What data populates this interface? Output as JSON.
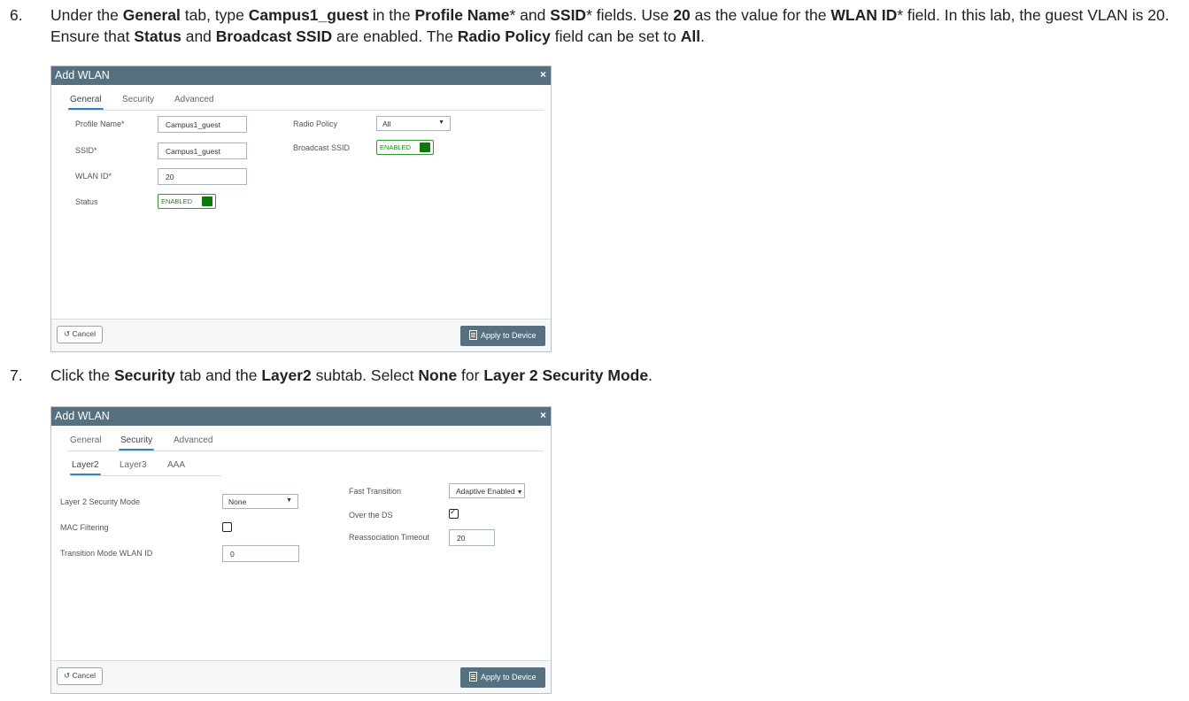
{
  "step6": {
    "number": "6.",
    "parts": [
      {
        "t": "Under the ",
        "b": false
      },
      {
        "t": "General",
        "b": true
      },
      {
        "t": " tab, type ",
        "b": false
      },
      {
        "t": "Campus1_guest",
        "b": true
      },
      {
        "t": " in the ",
        "b": false
      },
      {
        "t": "Profile Name",
        "b": true
      },
      {
        "t": "* and ",
        "b": false
      },
      {
        "t": "SSID",
        "b": true
      },
      {
        "t": "* fields. Use ",
        "b": false
      },
      {
        "t": "20",
        "b": true
      },
      {
        "t": " as the value for the ",
        "b": false
      },
      {
        "t": "WLAN ID",
        "b": true
      },
      {
        "t": "* field. In this lab, the guest VLAN is 20. Ensure that ",
        "b": false
      },
      {
        "t": "Status",
        "b": true
      },
      {
        "t": " and ",
        "b": false
      },
      {
        "t": "Broadcast SSID",
        "b": true
      },
      {
        "t": " are enabled. The ",
        "b": false
      },
      {
        "t": "Radio Policy",
        "b": true
      },
      {
        "t": " field can be set to ",
        "b": false
      },
      {
        "t": "All",
        "b": true
      },
      {
        "t": ".",
        "b": false
      }
    ]
  },
  "step7": {
    "number": "7.",
    "parts": [
      {
        "t": "Click the ",
        "b": false
      },
      {
        "t": "Security",
        "b": true
      },
      {
        "t": " tab and the ",
        "b": false
      },
      {
        "t": "Layer2",
        "b": true
      },
      {
        "t": " subtab. Select ",
        "b": false
      },
      {
        "t": "None",
        "b": true
      },
      {
        "t": " for ",
        "b": false
      },
      {
        "t": "Layer 2 Security Mode",
        "b": true
      },
      {
        "t": ".",
        "b": false
      }
    ]
  },
  "dialog1": {
    "title": "Add WLAN",
    "close_icon": "×",
    "tabs": [
      "General",
      "Security",
      "Advanced"
    ],
    "active_tab": "General",
    "profile_name_label": "Profile Name*",
    "profile_name_value": "Campus1_guest",
    "ssid_label": "SSID*",
    "ssid_value": "Campus1_guest",
    "wlan_id_label": "WLAN ID*",
    "wlan_id_value": "20",
    "status_label": "Status",
    "status_toggle": "ENABLED",
    "radio_policy_label": "Radio Policy",
    "radio_policy_value": "All",
    "broadcast_ssid_label": "Broadcast SSID",
    "broadcast_ssid_toggle": "ENABLED",
    "cancel_label": "Cancel",
    "cancel_icon": "↺",
    "apply_label": "Apply to Device"
  },
  "dialog2": {
    "title": "Add WLAN",
    "close_icon": "×",
    "tabs": [
      "General",
      "Security",
      "Advanced"
    ],
    "active_tab": "Security",
    "subtabs": [
      "Layer2",
      "Layer3",
      "AAA"
    ],
    "active_subtab": "Layer2",
    "l2_mode_label": "Layer 2 Security Mode",
    "l2_mode_value": "None",
    "mac_filtering_label": "MAC Filtering",
    "mac_filtering_checked": false,
    "transition_label": "Transition Mode WLAN ID",
    "transition_value": "0",
    "fast_transition_label": "Fast Transition",
    "fast_transition_value": "Adaptive Enabled",
    "over_ds_label": "Over the DS",
    "over_ds_checked": true,
    "reassoc_label": "Reassociation Timeout",
    "reassoc_value": "20",
    "cancel_label": "Cancel",
    "cancel_icon": "↺",
    "apply_label": "Apply to Device"
  },
  "colors": {
    "header": "#56707f",
    "tab_underline": "#2b85c6",
    "toggle_green": "#0b7a0b"
  }
}
